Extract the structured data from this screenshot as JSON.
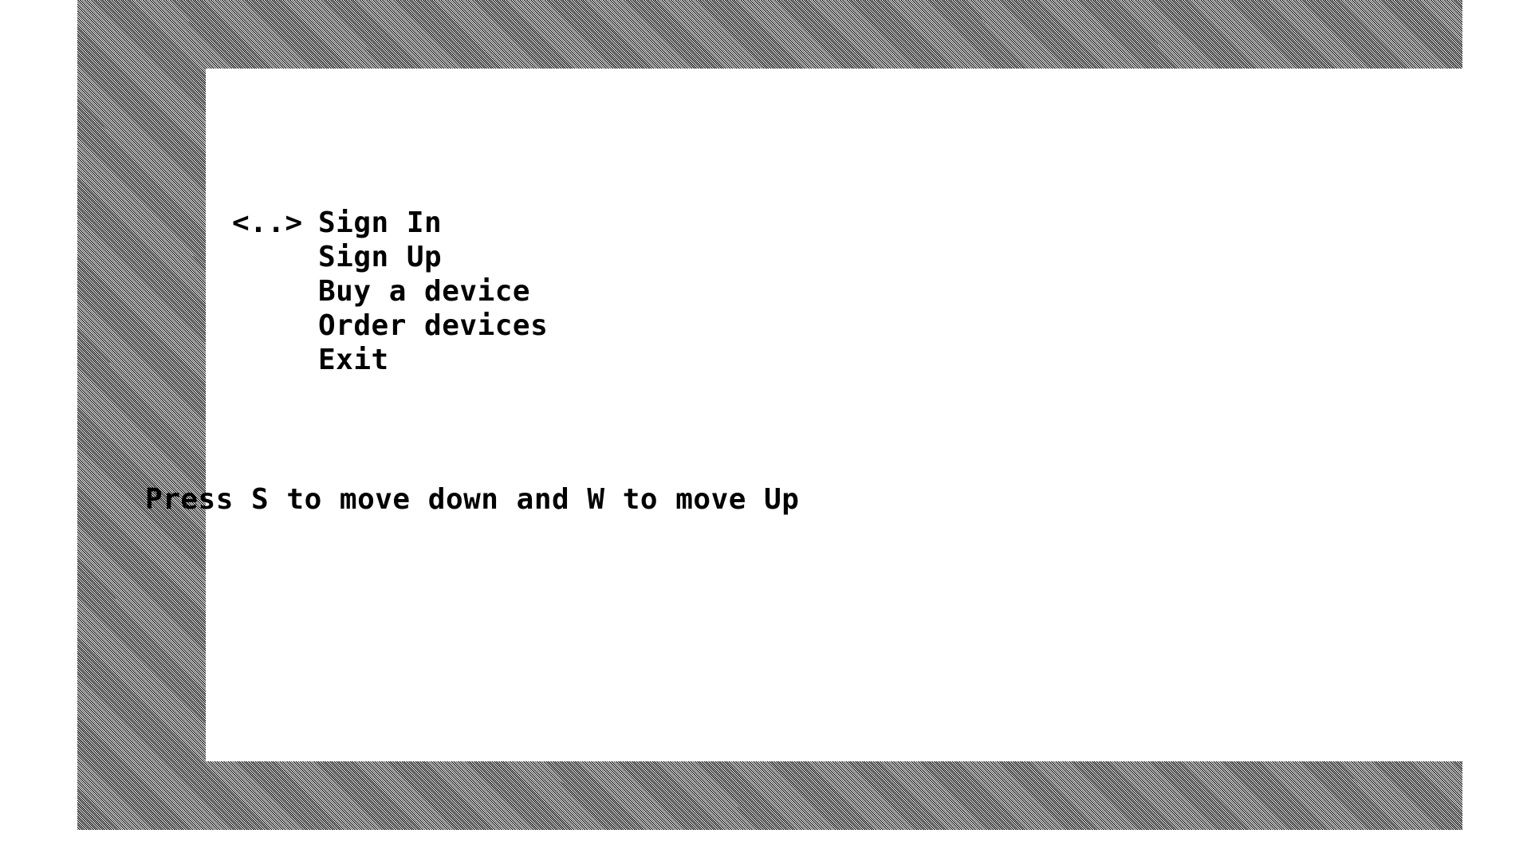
{
  "console": {
    "cursor": "<..>",
    "menu": {
      "items": [
        {
          "label": "Sign In",
          "selected": true
        },
        {
          "label": "Sign Up",
          "selected": false
        },
        {
          "label": "Buy a device",
          "selected": false
        },
        {
          "label": "Order devices",
          "selected": false
        },
        {
          "label": "Exit",
          "selected": false
        }
      ]
    },
    "hint": "Press S to move down and W to move Up"
  },
  "colors": {
    "text": "#000000",
    "screen_background": "#ffffff",
    "frame_pattern": "#8a8a8a"
  }
}
